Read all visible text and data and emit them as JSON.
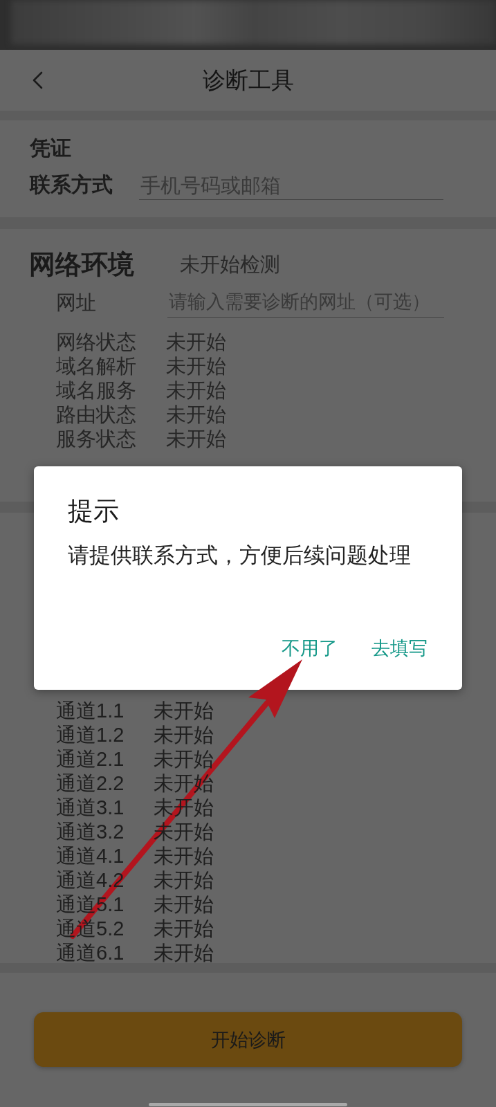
{
  "header": {
    "title": "诊断工具"
  },
  "credentials": {
    "title": "凭证",
    "contact": {
      "label": "联系方式",
      "placeholder": "手机号码或邮箱"
    }
  },
  "network": {
    "title": "网络环境",
    "status": "未开始检测",
    "url": {
      "label": "网址",
      "placeholder": "请输入需要诊断的网址（可选）"
    },
    "checks": [
      {
        "name": "网络状态",
        "status": "未开始"
      },
      {
        "name": "域名解析",
        "status": "未开始"
      },
      {
        "name": "域名服务",
        "status": "未开始"
      },
      {
        "name": "路由状态",
        "status": "未开始"
      },
      {
        "name": "服务状态",
        "status": "未开始"
      }
    ]
  },
  "channels": [
    {
      "name": "通道1.1",
      "status": "未开始"
    },
    {
      "name": "通道1.2",
      "status": "未开始"
    },
    {
      "name": "通道2.1",
      "status": "未开始"
    },
    {
      "name": "通道2.2",
      "status": "未开始"
    },
    {
      "name": "通道3.1",
      "status": "未开始"
    },
    {
      "name": "通道3.2",
      "status": "未开始"
    },
    {
      "name": "通道4.1",
      "status": "未开始"
    },
    {
      "name": "通道4.2",
      "status": "未开始"
    },
    {
      "name": "通道5.1",
      "status": "未开始"
    },
    {
      "name": "通道5.2",
      "status": "未开始"
    },
    {
      "name": "通道6.1",
      "status": "未开始"
    }
  ],
  "start_button": {
    "label": "开始诊断"
  },
  "dialog": {
    "title": "提示",
    "message": "请提供联系方式，方便后续问题处理",
    "buttons": [
      {
        "label": "不用了"
      },
      {
        "label": "去填写"
      }
    ]
  }
}
